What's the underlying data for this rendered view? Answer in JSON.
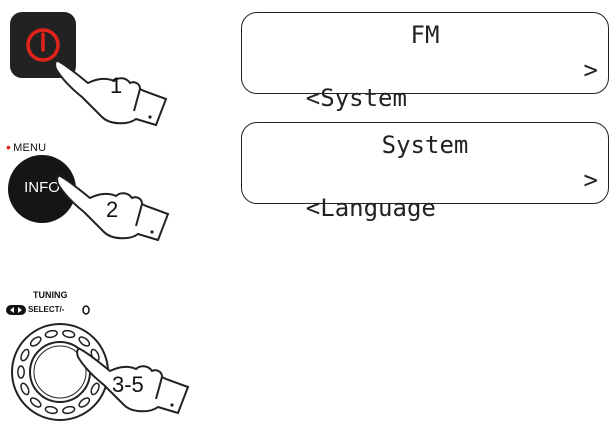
{
  "steps": {
    "step1": "1",
    "step2": "2",
    "step3": "3-5"
  },
  "buttons": {
    "info_label": "INFO",
    "menu_label": "MENU",
    "tuning_label": "TUNING",
    "select_label": "SELECT/-",
    "power_icon": "power-icon",
    "accent_color": "#e2231a"
  },
  "displays": [
    {
      "title": "FM",
      "item": "<System",
      "arrow": ">"
    },
    {
      "title": "System",
      "item": "<Language",
      "arrow": ">"
    }
  ]
}
